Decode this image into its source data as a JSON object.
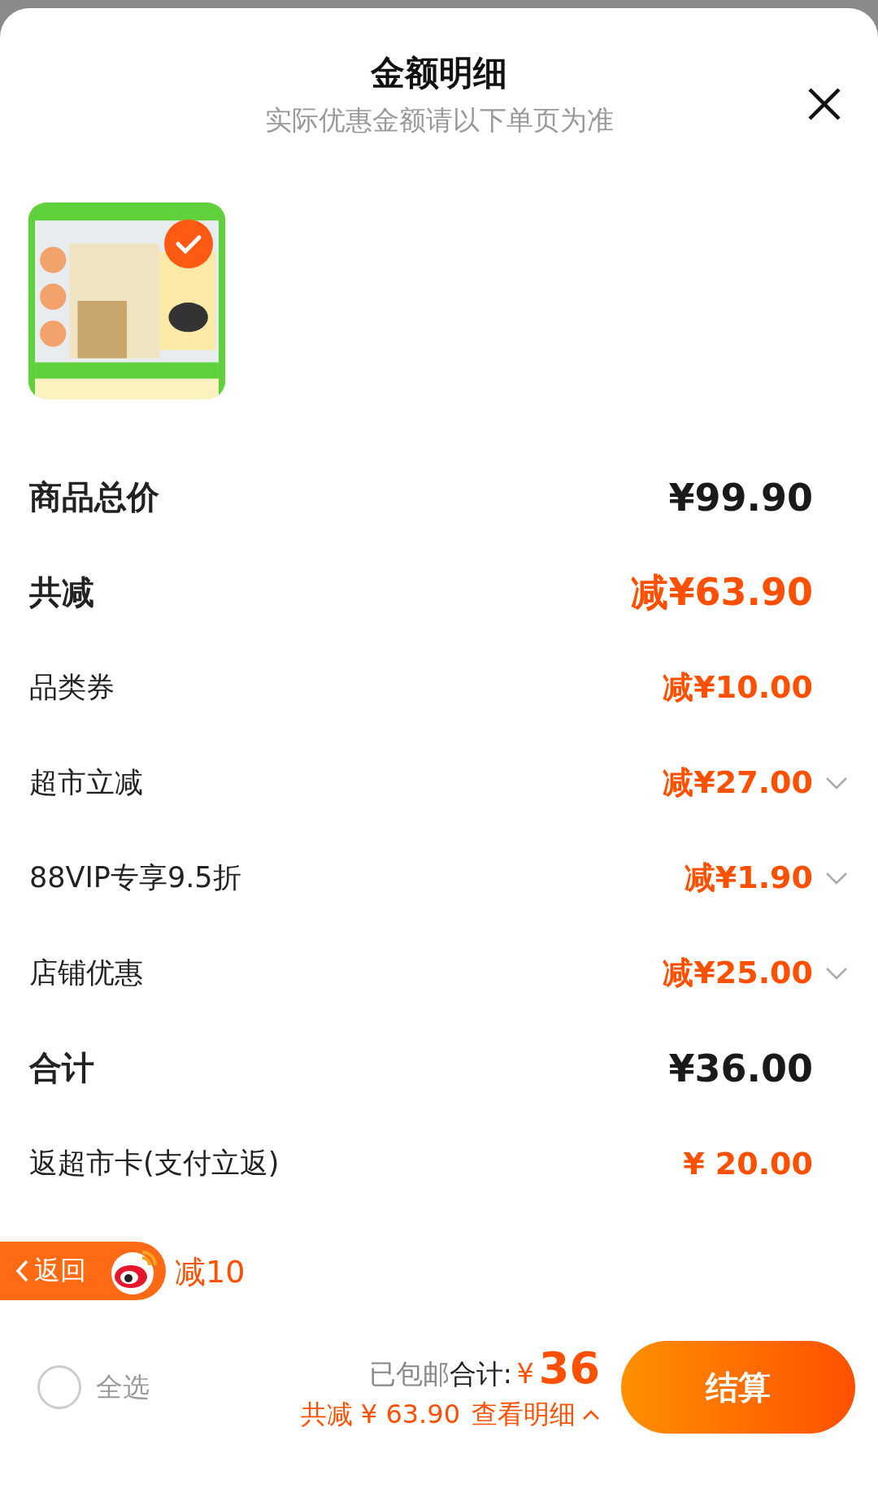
{
  "sheet": {
    "title": "金额明细",
    "subtitle": "实际优惠金额请以下单页为准"
  },
  "product": {
    "selected": true
  },
  "rows": [
    {
      "label": "商品总价",
      "value": "¥99.90",
      "kind": "heading",
      "color": "#1a1a1a",
      "expandable": false
    },
    {
      "label": "共减",
      "value": "减¥63.90",
      "kind": "heading",
      "color": "#ff5000",
      "expandable": false
    },
    {
      "label": "品类券",
      "value": "减¥10.00",
      "kind": "item",
      "color": "#ff5000",
      "expandable": false
    },
    {
      "label": "超市立减",
      "value": "减¥27.00",
      "kind": "item",
      "color": "#ff5000",
      "expandable": true
    },
    {
      "label": "88VIP专享9.5折",
      "value": "减¥1.90",
      "kind": "item",
      "color": "#ff5000",
      "expandable": true
    },
    {
      "label": "店铺优惠",
      "value": "减¥25.00",
      "kind": "item",
      "color": "#ff5000",
      "expandable": true
    },
    {
      "label": "合计",
      "value": "¥36.00",
      "kind": "heading",
      "color": "#1a1a1a",
      "expandable": false
    },
    {
      "label": "返超市卡(支付立返)",
      "value": "¥ 20.00",
      "kind": "item",
      "color": "#ff5000",
      "expandable": false
    }
  ],
  "promo": {
    "text": "减10"
  },
  "back_button": {
    "label": "返回"
  },
  "footer": {
    "select_all": {
      "label": "全选",
      "checked": false
    },
    "shipping": "已包邮",
    "total_label": "合计:",
    "currency": "¥",
    "total": "36",
    "saved": "共减 ¥ 63.90",
    "details_link": "查看明细",
    "checkout": "结算"
  }
}
